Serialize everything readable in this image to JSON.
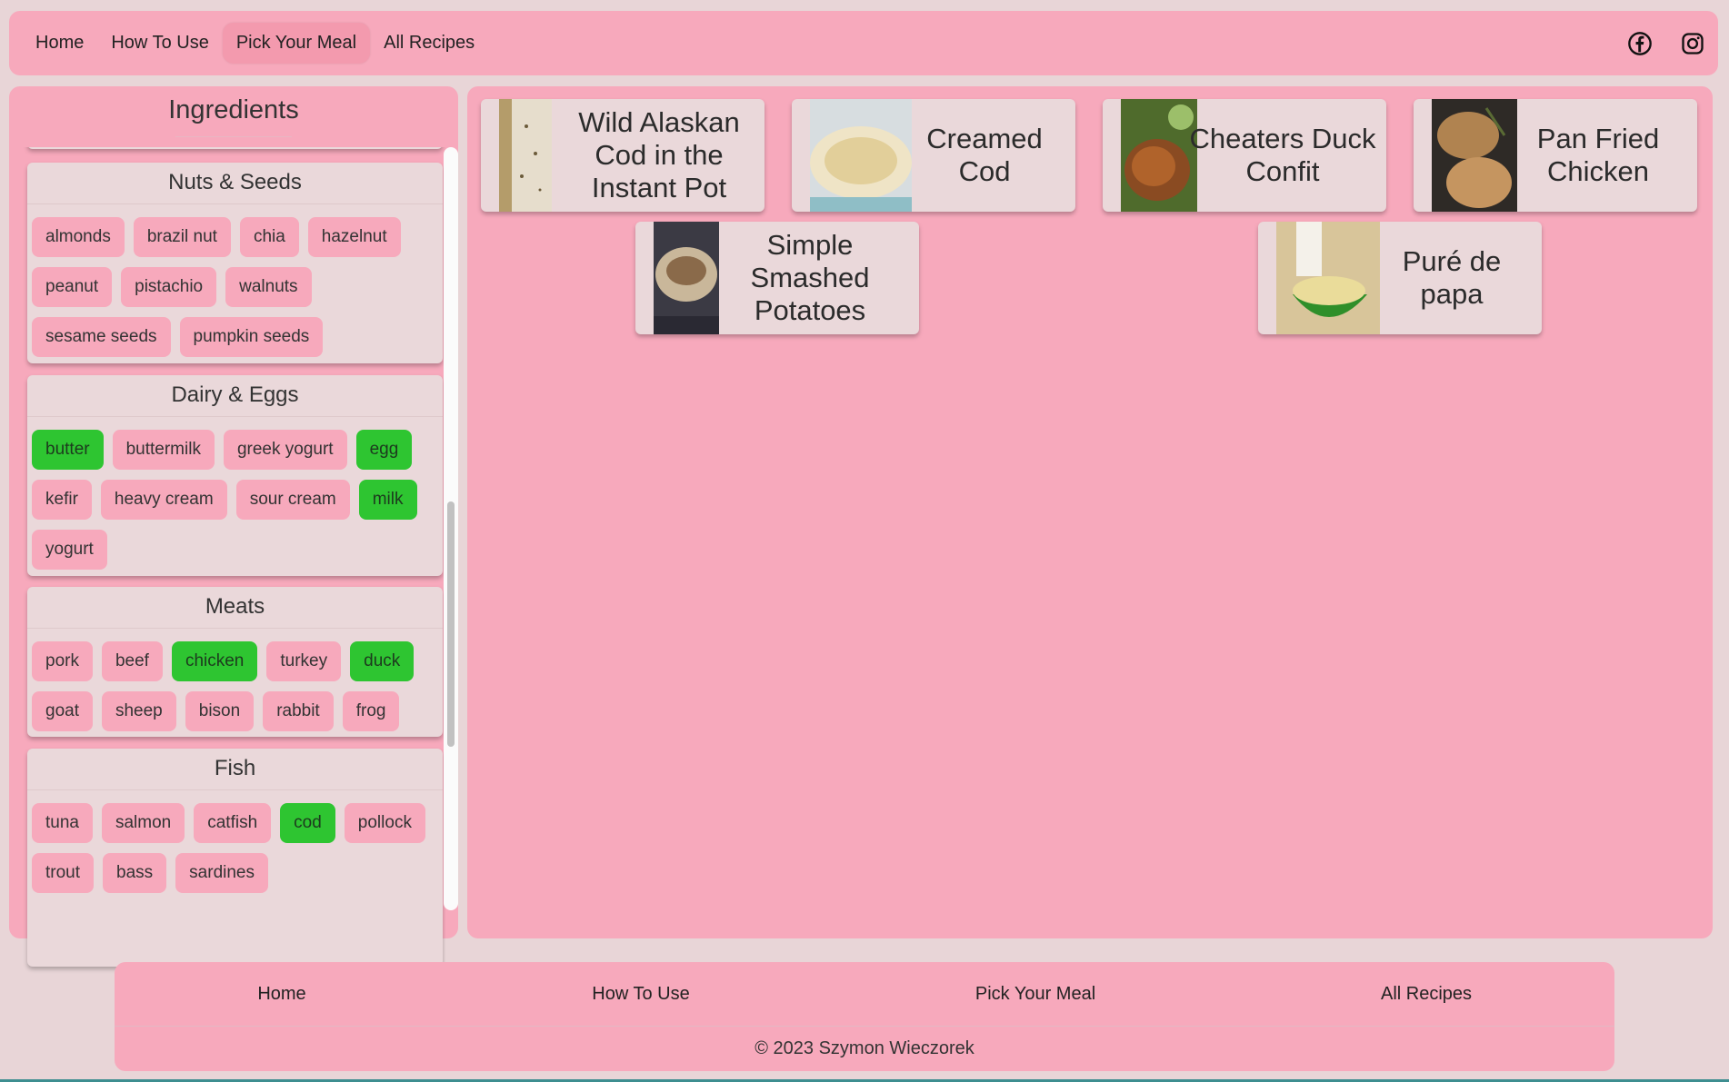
{
  "nav": {
    "links": [
      "Home",
      "How To Use",
      "Pick Your Meal",
      "All Recipes"
    ],
    "active": "Pick Your Meal",
    "social": [
      "facebook-icon",
      "instagram-icon"
    ]
  },
  "ingredients": {
    "title": "Ingredients",
    "categories": [
      {
        "name": "Nuts & Seeds",
        "items": [
          {
            "label": "almonds",
            "selected": false
          },
          {
            "label": "brazil nut",
            "selected": false
          },
          {
            "label": "chia",
            "selected": false
          },
          {
            "label": "hazelnut",
            "selected": false
          },
          {
            "label": "peanut",
            "selected": false
          },
          {
            "label": "pistachio",
            "selected": false
          },
          {
            "label": "walnuts",
            "selected": false
          },
          {
            "label": "sesame seeds",
            "selected": false
          },
          {
            "label": "pumpkin seeds",
            "selected": false
          }
        ]
      },
      {
        "name": "Dairy & Eggs",
        "items": [
          {
            "label": "butter",
            "selected": true
          },
          {
            "label": "buttermilk",
            "selected": false
          },
          {
            "label": "greek yogurt",
            "selected": false
          },
          {
            "label": "egg",
            "selected": true
          },
          {
            "label": "kefir",
            "selected": false
          },
          {
            "label": "heavy cream",
            "selected": false
          },
          {
            "label": "sour cream",
            "selected": false
          },
          {
            "label": "milk",
            "selected": true
          },
          {
            "label": "yogurt",
            "selected": false
          }
        ]
      },
      {
        "name": "Meats",
        "items": [
          {
            "label": "pork",
            "selected": false
          },
          {
            "label": "beef",
            "selected": false
          },
          {
            "label": "chicken",
            "selected": true
          },
          {
            "label": "turkey",
            "selected": false
          },
          {
            "label": "duck",
            "selected": true
          },
          {
            "label": "goat",
            "selected": false
          },
          {
            "label": "sheep",
            "selected": false
          },
          {
            "label": "bison",
            "selected": false
          },
          {
            "label": "rabbit",
            "selected": false
          },
          {
            "label": "frog",
            "selected": false
          }
        ]
      },
      {
        "name": "Fish",
        "items": [
          {
            "label": "tuna",
            "selected": false
          },
          {
            "label": "salmon",
            "selected": false
          },
          {
            "label": "catfish",
            "selected": false
          },
          {
            "label": "cod",
            "selected": true
          },
          {
            "label": "pollock",
            "selected": false
          },
          {
            "label": "trout",
            "selected": false
          },
          {
            "label": "bass",
            "selected": false
          },
          {
            "label": "sardines",
            "selected": false
          }
        ]
      }
    ]
  },
  "recipes": [
    {
      "title": "Wild Alaskan Cod in the Instant Pot",
      "thumb": "fish-photo"
    },
    {
      "title": "Creamed Cod",
      "thumb": "cream-dish-photo"
    },
    {
      "title": "Cheaters Duck Confit",
      "thumb": "duck-photo"
    },
    {
      "title": "Pan Fried Chicken",
      "thumb": "chicken-photo"
    },
    {
      "title": "Simple Smashed Potatoes",
      "thumb": "potato-photo"
    },
    {
      "title": "Puré de papa",
      "thumb": "mashed-potato-photo"
    }
  ],
  "footer": {
    "links": [
      "Home",
      "How To Use",
      "Pick Your Meal",
      "All Recipes"
    ],
    "copyright": "© 2023 Szymon Wieczorek"
  },
  "colors": {
    "page_bg": "#e8d5d7",
    "panel_pink": "#f7a9bc",
    "card_bg": "#ead8da",
    "selected_green": "#2ec531"
  }
}
